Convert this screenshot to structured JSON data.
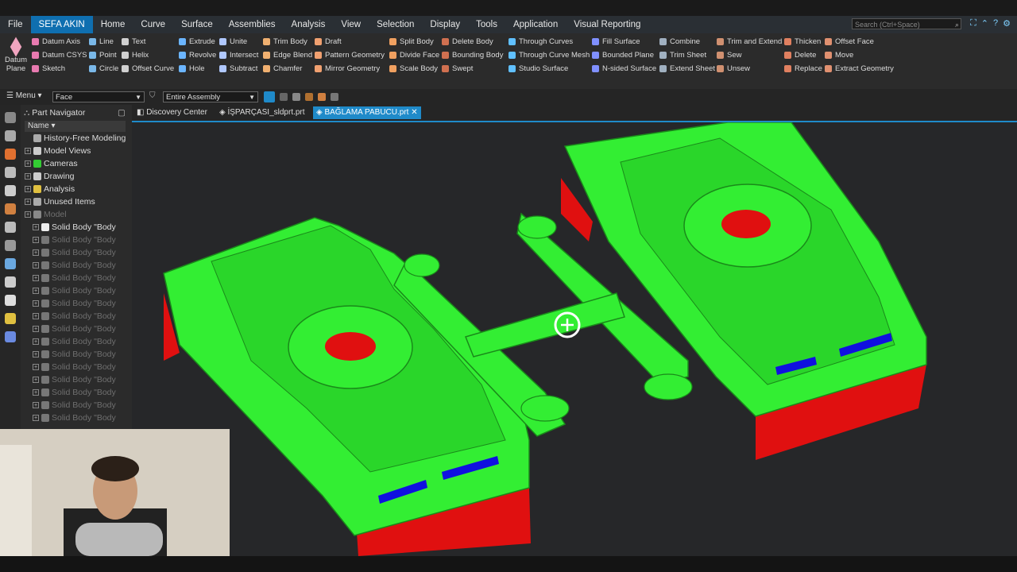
{
  "menu": {
    "items": [
      "File",
      "SEFA AKIN",
      "Home",
      "Curve",
      "Surface",
      "Assemblies",
      "Analysis",
      "View",
      "Selection",
      "Display",
      "Tools",
      "Application",
      "Visual Reporting"
    ],
    "active_index": 1,
    "search_placeholder": "Search (Ctrl+Space)"
  },
  "ribbon": {
    "datum_plane": [
      "Datum",
      "Plane"
    ],
    "columns": [
      [
        "Datum Axis",
        "Datum CSYS",
        "Sketch"
      ],
      [
        "Line",
        "Point",
        "Circle"
      ],
      [
        "Text",
        "Helix",
        "Offset Curve"
      ],
      [
        "Extrude",
        "Revolve",
        "Hole"
      ],
      [
        "Unite",
        "Intersect",
        "Subtract"
      ],
      [
        "Trim Body",
        "Edge Blend",
        "Chamfer"
      ],
      [
        "Draft",
        "Pattern Geometry",
        "Mirror Geometry"
      ],
      [
        "Split Body",
        "Divide Face",
        "Scale Body"
      ],
      [
        "Delete Body",
        "Bounding Body",
        "Swept"
      ],
      [
        "Through Curves",
        "Through Curve Mesh",
        "Studio Surface"
      ],
      [
        "Fill Surface",
        "Bounded Plane",
        "N-sided Surface"
      ],
      [
        "Combine",
        "Trim Sheet",
        "Extend Sheet"
      ],
      [
        "Trim and Extend",
        "Sew",
        "Unsew"
      ],
      [
        "Thicken",
        "Delete",
        "Replace"
      ],
      [
        "Offset Face",
        "Move",
        "Extract Geometry"
      ]
    ]
  },
  "toolbar": {
    "menu_label": "Menu",
    "filter_value": "Face",
    "scope_value": "Entire Assembly"
  },
  "tabs": [
    "Discovery Center",
    "İŞPARÇASI_sldprt.prt",
    "BAĞLAMA PABUCU.prt"
  ],
  "navigator": {
    "title": "Part Navigator",
    "column": "Name",
    "items": [
      {
        "label": "History-Free Modeling",
        "dim": false
      },
      {
        "label": "Model Views",
        "dim": false
      },
      {
        "label": "Cameras",
        "dim": false
      },
      {
        "label": "Drawing",
        "dim": false
      },
      {
        "label": "Analysis",
        "dim": false
      },
      {
        "label": "Unused Items",
        "dim": false
      },
      {
        "label": "Model",
        "dim": true
      },
      {
        "label": "Solid Body \"Body",
        "dim": false
      },
      {
        "label": "Solid Body \"Body",
        "dim": true
      },
      {
        "label": "Solid Body \"Body",
        "dim": true
      },
      {
        "label": "Solid Body \"Body",
        "dim": true
      },
      {
        "label": "Solid Body \"Body",
        "dim": true
      },
      {
        "label": "Solid Body \"Body",
        "dim": true
      },
      {
        "label": "Solid Body \"Body",
        "dim": true
      },
      {
        "label": "Solid Body \"Body",
        "dim": true
      },
      {
        "label": "Solid Body \"Body",
        "dim": true
      },
      {
        "label": "Solid Body \"Body",
        "dim": true
      },
      {
        "label": "Solid Body \"Body",
        "dim": true
      },
      {
        "label": "Solid Body \"Body",
        "dim": true
      },
      {
        "label": "Solid Body \"Body",
        "dim": true
      },
      {
        "label": "Solid Body \"Body",
        "dim": true
      },
      {
        "label": "Solid Body \"Body",
        "dim": true
      },
      {
        "label": "Solid Body \"Body",
        "dim": true
      }
    ]
  },
  "colors": {
    "accent": "#1f8ac9",
    "model_green": "#33ee33",
    "model_red": "#e01010",
    "model_blue": "#1010e0"
  }
}
